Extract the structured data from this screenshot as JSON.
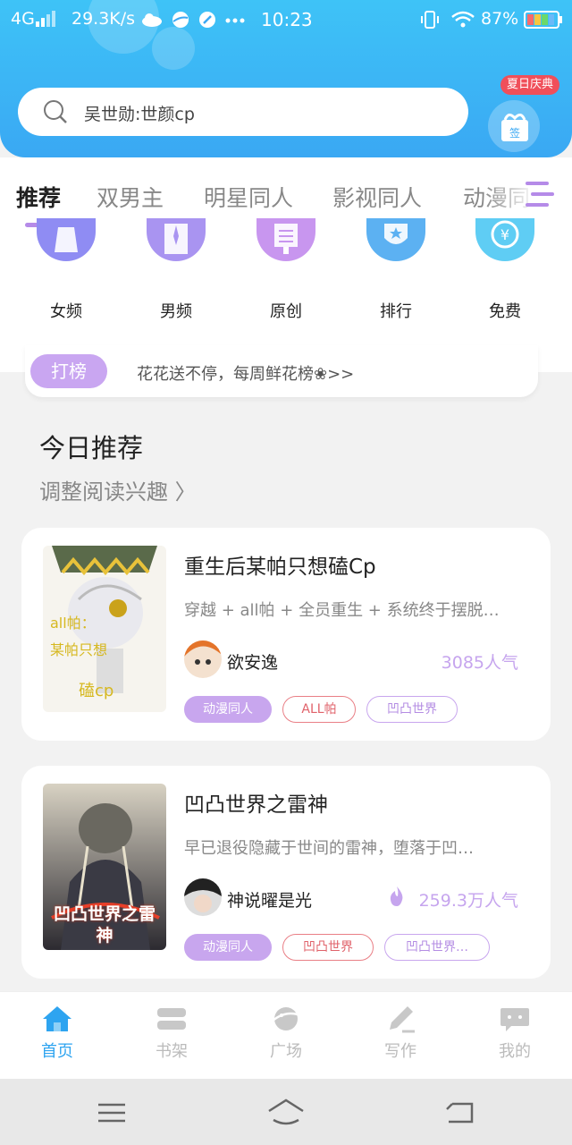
{
  "status": {
    "network": "4G",
    "speed": "29.3K/s",
    "time": "10:23",
    "battery": "87%",
    "icons": [
      "signal-icon",
      "cloud-icon",
      "planet-icon",
      "brush-icon",
      "more-icon",
      "vibrate-icon",
      "wifi-icon",
      "battery-icon"
    ]
  },
  "header": {
    "search_query": "吴世勋:世颜cp",
    "promo_badge": "夏日庆典",
    "sign_label": "签",
    "brand_color": "#3aa8f3"
  },
  "tabs": [
    {
      "label": "推荐",
      "active": true
    },
    {
      "label": "双男主",
      "active": false
    },
    {
      "label": "明星同人",
      "active": false
    },
    {
      "label": "影视同人",
      "active": false
    },
    {
      "label": "动漫同",
      "active": false
    }
  ],
  "categories": [
    {
      "label": "女频",
      "icon": "dress-icon",
      "color": "#8f8cf3"
    },
    {
      "label": "男频",
      "icon": "suit-icon",
      "color": "#a994f1"
    },
    {
      "label": "原创",
      "icon": "book-stand-icon",
      "color": "#c896ef"
    },
    {
      "label": "排行",
      "icon": "trophy-icon",
      "color": "#5cb1f2"
    },
    {
      "label": "免费",
      "icon": "yen-icon",
      "color": "#5fcdf4"
    }
  ],
  "ranking": {
    "badge": "打榜",
    "text": "花花送不停，每周鲜花榜❀>>"
  },
  "today": {
    "title": "今日推荐",
    "subtitle": "调整阅读兴趣 〉"
  },
  "books": [
    {
      "title": "重生后某帕只想磕Cp",
      "desc": "穿越 + all帕 + 全员重生 + 系统终于摆脱…",
      "author": "欲安逸",
      "popularity": "3085人气",
      "tags": [
        "动漫同人",
        "ALL帕",
        "凹凸世界"
      ]
    },
    {
      "title": "凹凸世界之雷神",
      "desc": "早已退役隐藏于世间的雷神，堕落于凹…",
      "author": "神说曜是光",
      "popularity": "259.3万人气",
      "tags": [
        "动漫同人",
        "凹凸世界",
        "凹凸世界…"
      ],
      "cover_text": "凹凸世界之雷神"
    }
  ],
  "bottom_nav": [
    {
      "label": "首页",
      "icon": "home-icon",
      "active": true
    },
    {
      "label": "书架",
      "icon": "bookshelf-icon",
      "active": false
    },
    {
      "label": "广场",
      "icon": "planet-icon",
      "active": false
    },
    {
      "label": "写作",
      "icon": "pen-icon",
      "active": false
    },
    {
      "label": "我的",
      "icon": "chat-bubble-icon",
      "active": false
    }
  ]
}
